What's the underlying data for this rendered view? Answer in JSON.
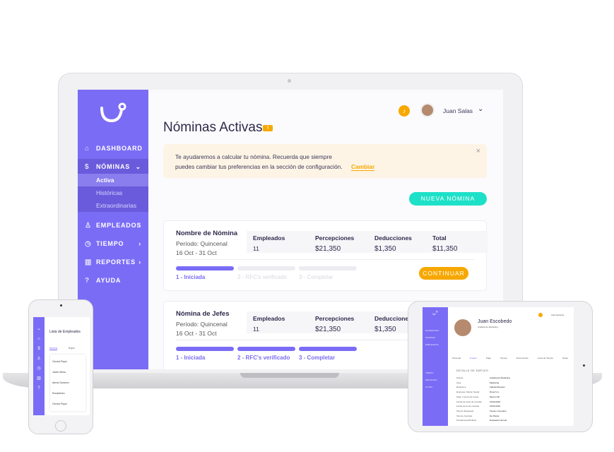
{
  "laptop": {
    "sidebar": {
      "items": [
        {
          "label": "DASHBOARD",
          "icon": "home-icon"
        },
        {
          "label": "NÓMINAS",
          "icon": "dollar-icon",
          "expanded": true,
          "sub": [
            "Activa",
            "Históricas",
            "Extraordinarias"
          ]
        },
        {
          "label": "EMPLEADOS",
          "icon": "user-icon"
        },
        {
          "label": "TIEMPO",
          "icon": "clock-icon"
        },
        {
          "label": "REPORTES",
          "icon": "chart-icon"
        },
        {
          "label": "AYUDA",
          "icon": "question-icon"
        }
      ]
    },
    "header": {
      "user": "Juan Salas",
      "notification_icon": "bell-icon"
    },
    "title": "Nóminas Activas",
    "badge": "!",
    "alert": {
      "line1": "Te ayudaremos a calcular tu nómina. Recuerda que siempre",
      "line2": "puedes cambiar tus preferencias en la sección de configuración.",
      "link": "Cambiar",
      "close": "×"
    },
    "new_button": "NUEVA NÓMINA",
    "cards": [
      {
        "name": "Nombre de Nómina",
        "period": "Período: Quincenal",
        "dates": "16 Oct - 31 Oct",
        "stats": [
          {
            "label": "Empleados",
            "value": "11"
          },
          {
            "label": "Percepciones",
            "value": "$21,350"
          },
          {
            "label": "Deducciones",
            "value": "$1,350"
          },
          {
            "label": "Total",
            "value": "$11,350"
          }
        ],
        "steps": [
          "1 - Iniciada",
          "2 - RFC's verificado",
          "3 - Completar"
        ],
        "progress_steps_done": 1,
        "action": "CONTINUAR"
      },
      {
        "name": "Nómina de Jefes",
        "period": "Período: Quincenal",
        "dates": "16 Oct - 31 Oct",
        "stats": [
          {
            "label": "Empleados",
            "value": "11"
          },
          {
            "label": "Percepciones",
            "value": "$21,350"
          },
          {
            "label": "Deducciones",
            "value": "$1,350"
          }
        ],
        "steps": [
          "1 - Iniciada",
          "2 - RFC's verificado",
          "3 - Completar"
        ],
        "progress_steps_done": 3
      }
    ]
  },
  "phone": {
    "title": "Lista de Empleados",
    "tabs": [
      "Activos",
      "Bajas"
    ],
    "employees": [
      "Gerard Pique",
      "Javier Mesa",
      "Alexis Sanchez",
      "Ronaldinho",
      "Gerard Pique"
    ]
  },
  "tablet": {
    "user": "Administrador",
    "name": "Juan Escobedo",
    "role": "Analista de Marketing",
    "tabs": [
      "Personal",
      "Empleo",
      "Pago",
      "Tiempo",
      "Documentos",
      "Linea de Tiempo",
      "Notas"
    ],
    "section": "DETALLE DE EMPLEO",
    "details": [
      [
        "Puesto",
        "Analista de Marketing"
      ],
      [
        "Area",
        "Marketing"
      ],
      [
        "Reporta a",
        "Fabiola Borquez"
      ],
      [
        "Empresa / Razón Social",
        "Runa S.A."
      ],
      [
        "Sede / Centro de Costo",
        "Mexico DF"
      ],
      [
        "Fecha de inicio de contrato",
        "15/01/2018"
      ],
      [
        "Fecha de fin de contrato",
        "15/01/2019"
      ],
      [
        "Tipo de Empleado",
        "Tiempo Completo"
      ],
      [
        "Tipo de Contrato",
        "De Planta"
      ],
      [
        "Prestaciones/Política",
        "Empleado Normal"
      ]
    ],
    "nav": [
      "DASHBOARD",
      "NÓMINAS",
      "EMPLEADOS",
      "TIEMPO",
      "REPORTES",
      "AYUDA"
    ]
  },
  "colors": {
    "primary": "#7b6cf6",
    "accent": "#1de0c8",
    "warning": "#f7a800",
    "alert_bg": "#fdf4e6"
  }
}
